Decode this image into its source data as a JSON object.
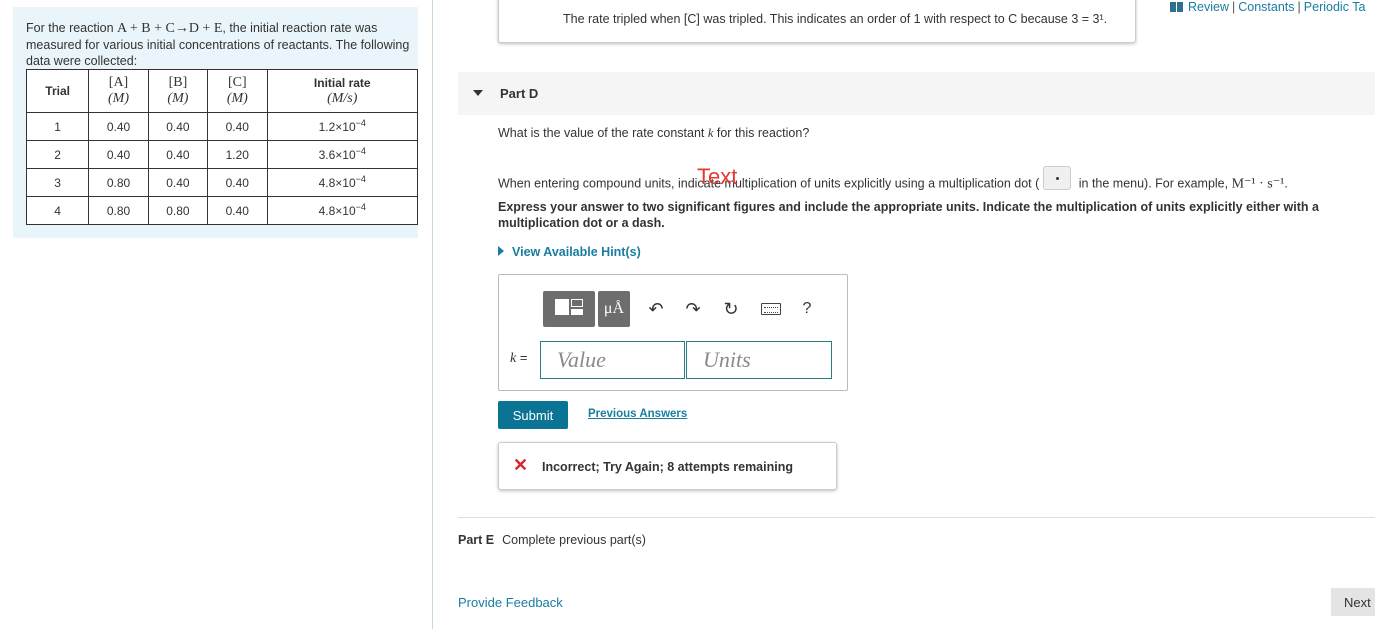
{
  "problem": {
    "intro_1": "For the reaction ",
    "reaction": "A + B + C→D + E",
    "intro_2": ", the initial reaction rate was measured for various initial concentrations of reactants. The following data were collected:",
    "table": {
      "headers": {
        "trial": "Trial",
        "a": "[A]",
        "b": "[B]",
        "c": "[C]",
        "conc_unit": "(M)",
        "rate": "Initial rate",
        "rate_unit": "(M/s)"
      },
      "rows": [
        {
          "trial": "1",
          "a": "0.40",
          "b": "0.40",
          "c": "0.40",
          "rate_base": "1.2×10",
          "rate_exp": "−4"
        },
        {
          "trial": "2",
          "a": "0.40",
          "b": "0.40",
          "c": "1.20",
          "rate_base": "3.6×10",
          "rate_exp": "−4"
        },
        {
          "trial": "3",
          "a": "0.80",
          "b": "0.40",
          "c": "0.40",
          "rate_base": "4.8×10",
          "rate_exp": "−4"
        },
        {
          "trial": "4",
          "a": "0.80",
          "b": "0.80",
          "c": "0.40",
          "rate_base": "4.8×10",
          "rate_exp": "−4"
        }
      ]
    }
  },
  "top_links": {
    "review": "Review",
    "constants": "Constants",
    "periodic": "Periodic Ta",
    "sep": "|"
  },
  "prev_feedback": "The rate tripled when [C] was tripled. This indicates an order of 1 with respect to C because 3 = 3¹.",
  "part_d": {
    "label": "Part D",
    "question_1": "What is the value of the rate constant ",
    "question_k": "k",
    "question_2": " for this reaction?",
    "instr_1": "When entering compound units, indicate multiplication of units explicitly using a multiplication dot (",
    "instr_2": " in the menu). For example, ",
    "instr_example": "M⁻¹ · s⁻¹",
    "instr_3": ".",
    "overlay_text": "Text",
    "express": "Express your answer to two significant figures and include the appropriate units. Indicate the multiplication of units explicitly either with a multiplication dot or a dash.",
    "hint": "View Available Hint(s)",
    "toolbar": {
      "units": "μÅ",
      "undo": "↶",
      "redo": "↷",
      "reset": "↻",
      "help": "?"
    },
    "k_label": "k",
    "k_eq": " =",
    "value_placeholder": "Value",
    "units_placeholder": "Units",
    "submit": "Submit",
    "previous_answers": "Previous Answers",
    "feedback_icon": "✕",
    "feedback": "Incorrect; Try Again; 8 attempts remaining"
  },
  "part_e": {
    "label": "Part E",
    "text": "Complete previous part(s)"
  },
  "footer": {
    "provide_feedback": "Provide Feedback",
    "next": "Next"
  }
}
